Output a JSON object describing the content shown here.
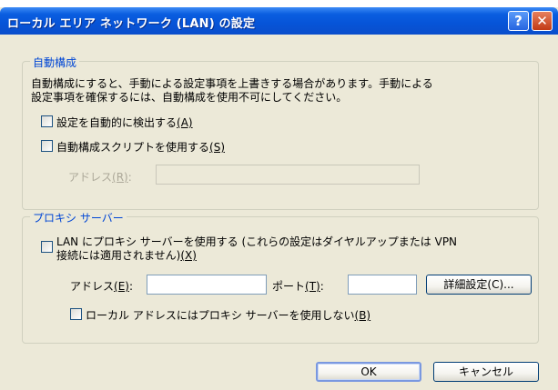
{
  "window": {
    "title": "ローカル エリア ネットワーク (LAN) の設定",
    "help_glyph": "?",
    "close_glyph": "✕"
  },
  "auto_config": {
    "legend": "自動構成",
    "description_line1": "自動構成にすると、手動による設定事項を上書きする場合があります。手動による",
    "description_line2": "設定事項を確保するには、自動構成を使用不可にしてください。",
    "detect_checkbox": {
      "label": "設定を自動的に検出する",
      "accel": "(A)",
      "checked": false
    },
    "script_checkbox": {
      "label": "自動構成スクリプトを使用する",
      "accel": "(S)",
      "checked": false
    },
    "address": {
      "label": "アドレス",
      "accel": "(R)",
      "suffix": ":",
      "value": "",
      "enabled": false
    }
  },
  "proxy": {
    "legend": "プロキシ サーバー",
    "use_proxy_checkbox": {
      "line1": "LAN にプロキシ サーバーを使用する (これらの設定はダイヤルアップまたは VPN",
      "line2": "接続には適用されません)",
      "accel": "(X)",
      "checked": false
    },
    "address": {
      "label": "アドレス",
      "accel": "(E)",
      "suffix": ":",
      "value": ""
    },
    "port": {
      "label": "ポート",
      "accel": "(T)",
      "suffix": ":",
      "value": ""
    },
    "advanced_button": "詳細設定(C)...",
    "bypass_checkbox": {
      "label": "ローカル アドレスにはプロキシ サーバーを使用しない",
      "accel": "(B)",
      "checked": false
    }
  },
  "buttons": {
    "ok": "OK",
    "cancel": "キャンセル"
  },
  "colors": {
    "title_bar": "#0a5ee0",
    "dialog_bg": "#ece9d8",
    "group_legend": "#0046d5",
    "close_button": "#c23a15"
  }
}
